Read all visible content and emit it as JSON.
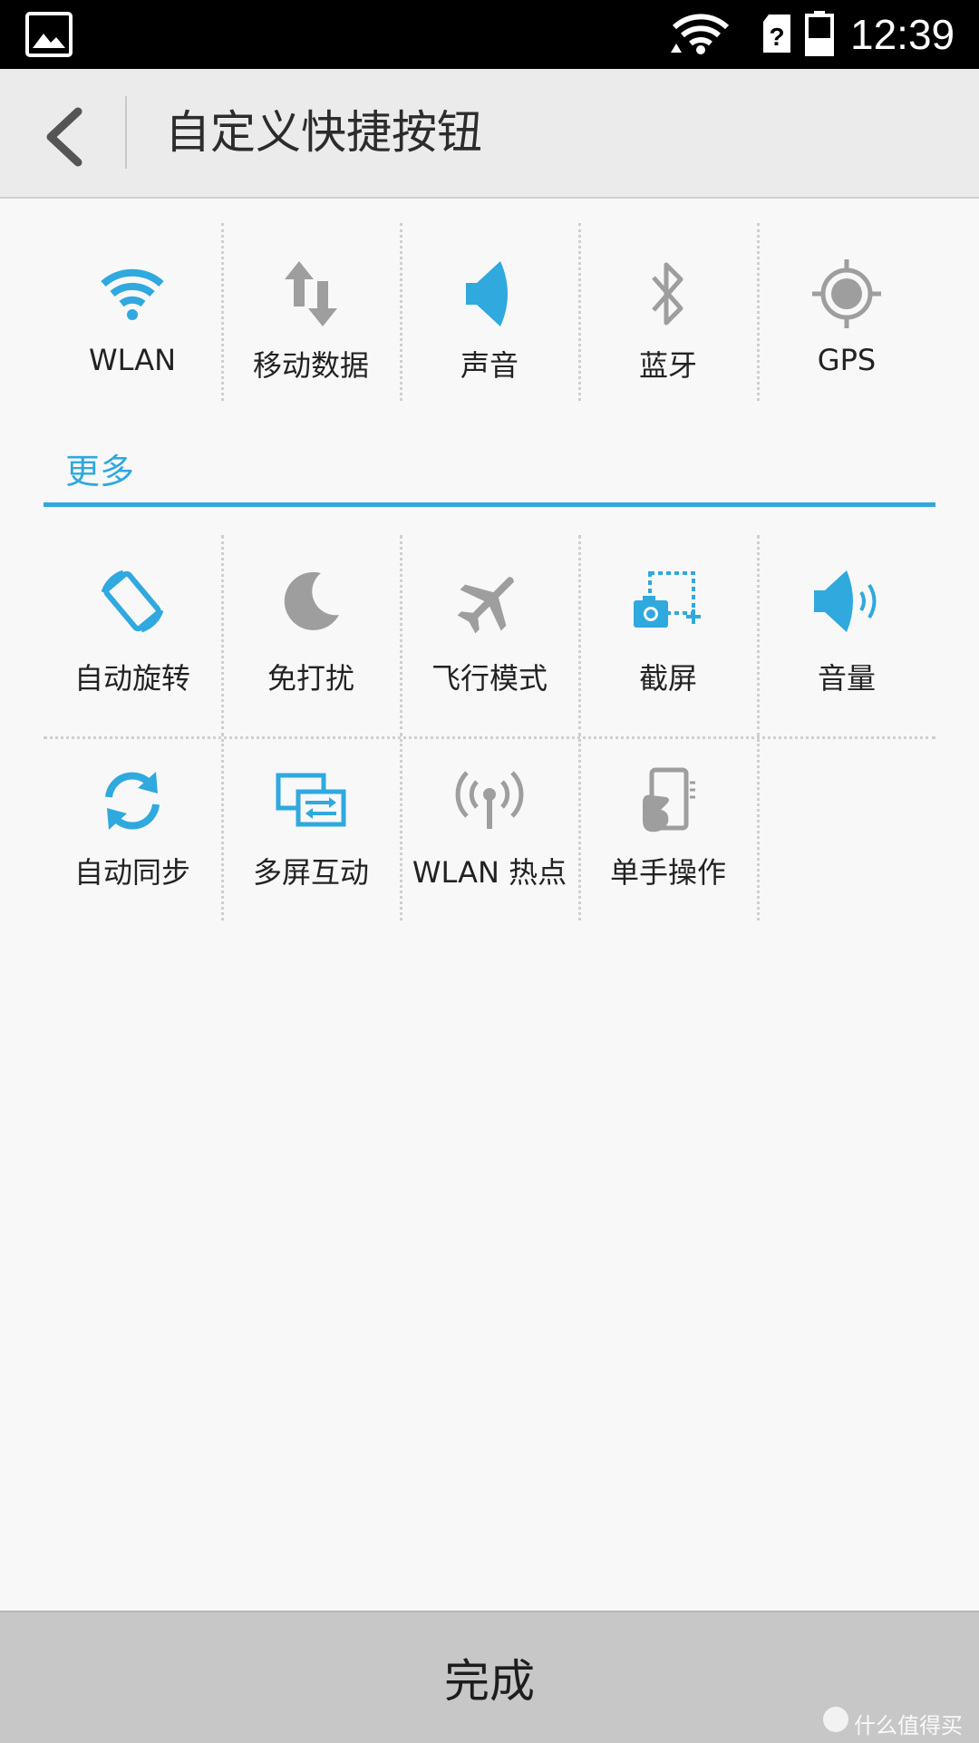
{
  "status_bar": {
    "time": "12:39"
  },
  "header": {
    "title": "自定义快捷按钮"
  },
  "top_tiles": [
    {
      "label": "WLAN",
      "icon": "wifi-icon",
      "active": true
    },
    {
      "label": "移动数据",
      "icon": "mobile-data-icon",
      "active": false
    },
    {
      "label": "声音",
      "icon": "sound-icon",
      "active": true
    },
    {
      "label": "蓝牙",
      "icon": "bluetooth-icon",
      "active": false
    },
    {
      "label": "GPS",
      "icon": "gps-icon",
      "active": false
    }
  ],
  "more_section": {
    "label": "更多",
    "row1": [
      {
        "label": "自动旋转",
        "icon": "auto-rotate-icon",
        "active": true
      },
      {
        "label": "免打扰",
        "icon": "do-not-disturb-icon",
        "active": false
      },
      {
        "label": "飞行模式",
        "icon": "airplane-icon",
        "active": false
      },
      {
        "label": "截屏",
        "icon": "screenshot-icon",
        "active": true
      },
      {
        "label": "音量",
        "icon": "volume-icon",
        "active": true
      }
    ],
    "row2": [
      {
        "label": "自动同步",
        "icon": "sync-icon",
        "active": true
      },
      {
        "label": "多屏互动",
        "icon": "multi-screen-icon",
        "active": true
      },
      {
        "label": "WLAN 热点",
        "icon": "hotspot-icon",
        "active": false
      },
      {
        "label": "单手操作",
        "icon": "one-hand-icon",
        "active": false
      }
    ]
  },
  "footer": {
    "done_label": "完成"
  },
  "watermark": "什么值得买",
  "colors": {
    "accent": "#2fa9de",
    "inactive": "#9e9e9e",
    "header_bg": "#ebebeb",
    "footer_bg": "#c7c7c7"
  }
}
